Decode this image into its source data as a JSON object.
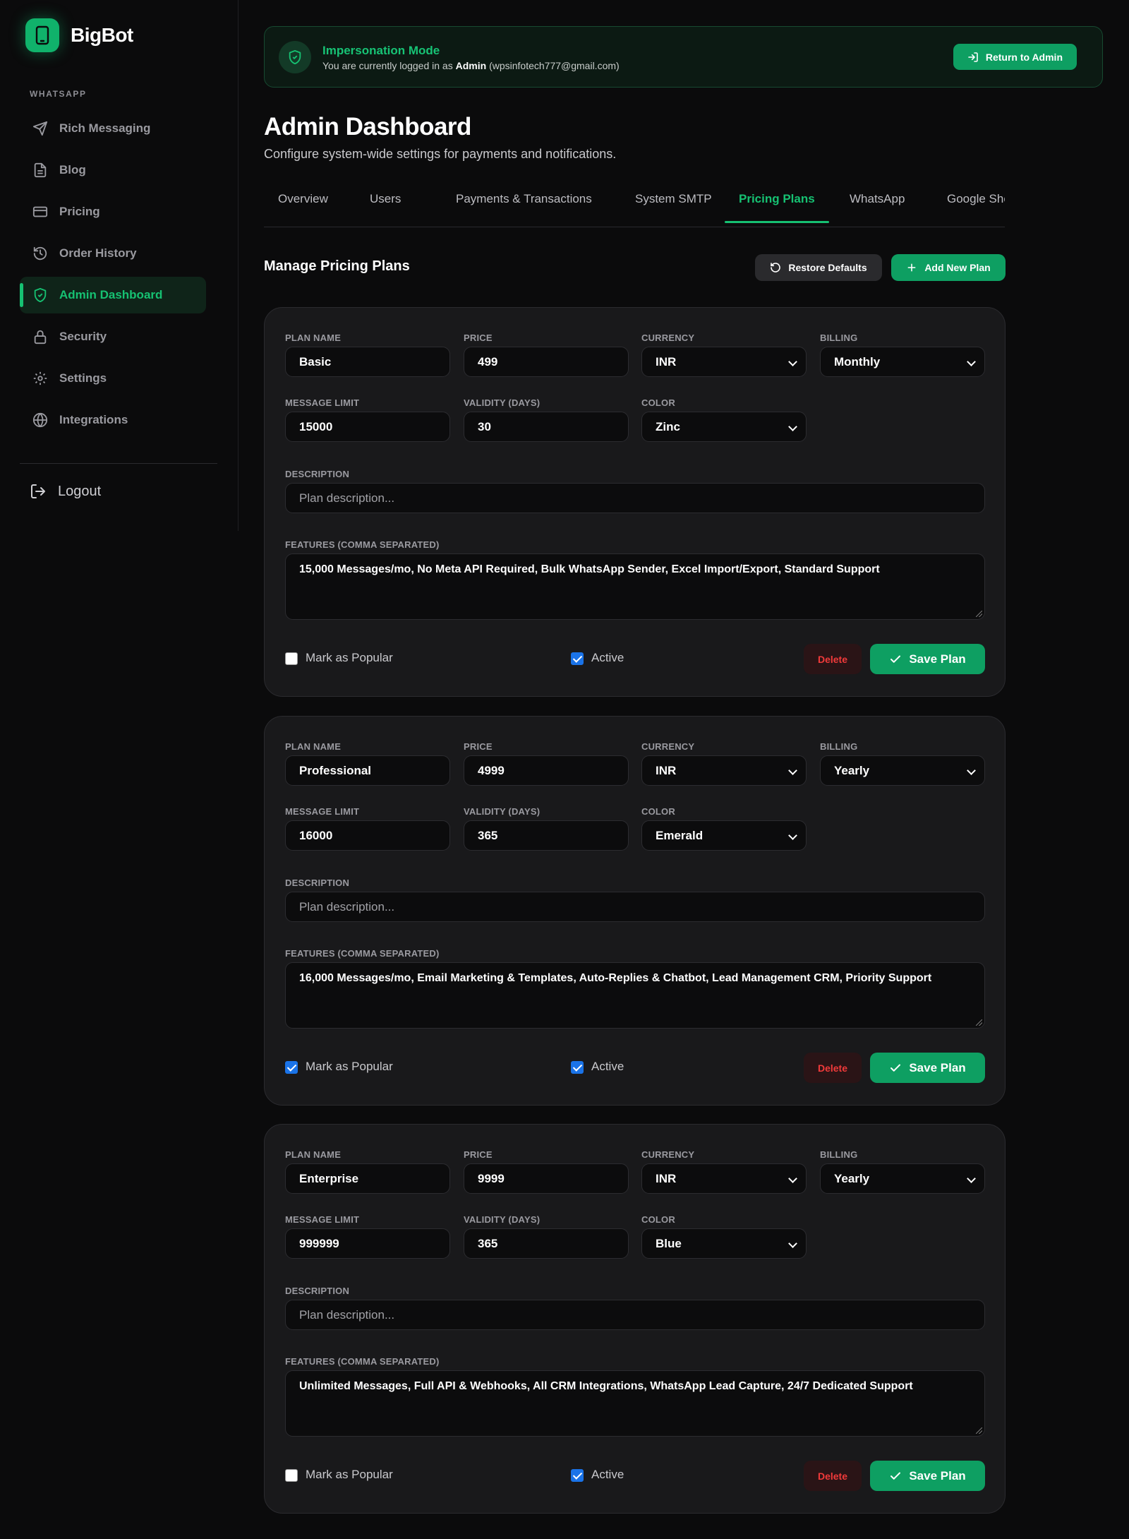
{
  "brand": {
    "name": "BigBot"
  },
  "sidebar": {
    "section_label": "WHATSAPP",
    "items": [
      {
        "label": "Rich Messaging",
        "icon": "send-icon"
      },
      {
        "label": "Blog",
        "icon": "document-icon"
      },
      {
        "label": "Pricing",
        "icon": "credit-card-icon"
      },
      {
        "label": "Order History",
        "icon": "history-icon"
      },
      {
        "label": "Admin Dashboard",
        "icon": "shield-check-icon",
        "active": true
      },
      {
        "label": "Security",
        "icon": "lock-icon"
      },
      {
        "label": "Settings",
        "icon": "gear-icon"
      },
      {
        "label": "Integrations",
        "icon": "globe-icon"
      }
    ],
    "logout_label": "Logout"
  },
  "banner": {
    "title": "Impersonation Mode",
    "text_prefix": "You are currently logged in as",
    "user_name": "Admin",
    "user_email": "(wpsinfotech777@gmail.com)",
    "return_label": "Return to Admin"
  },
  "header": {
    "title": "Admin Dashboard",
    "subtitle": "Configure system-wide settings for payments and notifications."
  },
  "tabs": [
    {
      "label": "Overview"
    },
    {
      "label": "Users"
    },
    {
      "label": "Payments & Transactions"
    },
    {
      "label": "System SMTP"
    },
    {
      "label": "Pricing Plans",
      "active": true
    },
    {
      "label": "WhatsApp"
    },
    {
      "label": "Google Sheets"
    }
  ],
  "section": {
    "title": "Manage Pricing Plans",
    "restore_label": "Restore Defaults",
    "add_label": "Add New Plan"
  },
  "labels": {
    "plan_name": "PLAN NAME",
    "price": "PRICE",
    "currency": "CURRENCY",
    "billing": "BILLING",
    "message_limit": "MESSAGE LIMIT",
    "validity": "VALIDITY (DAYS)",
    "color": "COLOR",
    "description": "DESCRIPTION",
    "features": "FEATURES (COMMA SEPARATED)",
    "description_placeholder": "Plan description...",
    "popular": "Mark as Popular",
    "active": "Active",
    "delete": "Delete",
    "save": "Save Plan"
  },
  "plans": [
    {
      "name": "Basic",
      "price": "499",
      "currency": "INR",
      "billing": "Monthly",
      "message_limit": "15000",
      "validity": "30",
      "color": "Zinc",
      "description": "",
      "features": "15,000 Messages/mo, No Meta API Required, Bulk WhatsApp Sender, Excel Import/Export, Standard Support",
      "popular": false,
      "active": true
    },
    {
      "name": "Professional",
      "price": "4999",
      "currency": "INR",
      "billing": "Yearly",
      "message_limit": "16000",
      "validity": "365",
      "color": "Emerald",
      "description": "",
      "features": "16,000 Messages/mo, Email Marketing & Templates, Auto-Replies & Chatbot, Lead Management CRM, Priority Support",
      "popular": true,
      "active": true
    },
    {
      "name": "Enterprise",
      "price": "9999",
      "currency": "INR",
      "billing": "Yearly",
      "message_limit": "999999",
      "validity": "365",
      "color": "Blue",
      "description": "",
      "features": "Unlimited Messages, Full API & Webhooks, All CRM Integrations, WhatsApp Lead Capture, 24/7 Dedicated Support",
      "popular": false,
      "active": true
    }
  ],
  "colors": {
    "accent": "#16c172",
    "accent_button": "#0e9f62",
    "danger": "#f03a3a",
    "background": "#0b0b0c",
    "card": "#19191b"
  }
}
